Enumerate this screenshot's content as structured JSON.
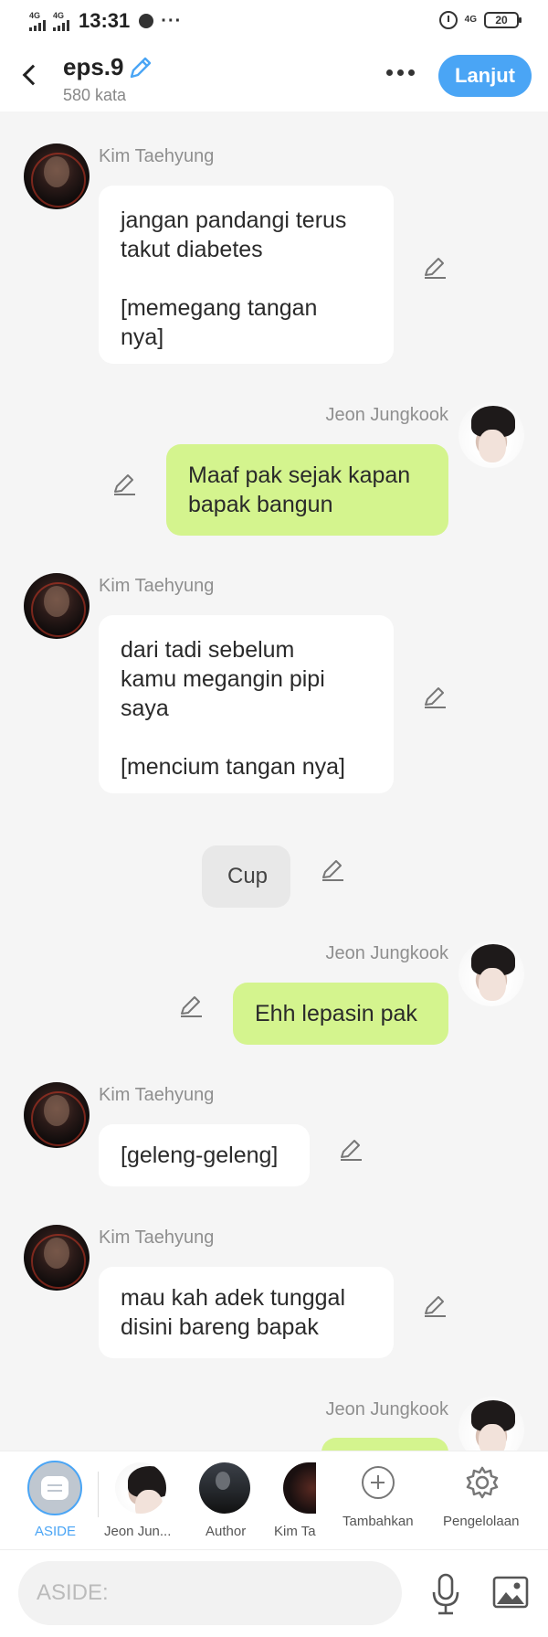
{
  "status_bar": {
    "signal1": "4G",
    "signal2": "4G",
    "time": "13:31",
    "dots": "···",
    "network": "4G",
    "battery": "20"
  },
  "header": {
    "title": "eps.9",
    "subtitle": "580 kata",
    "next_label": "Lanjut",
    "accent": "#4aa5f5"
  },
  "messages": [
    {
      "speaker": "Kim Taehyung",
      "side": "left",
      "text": "jangan pandangi terus\ntakut diabetes\n\n[memegang tangan\nnya]"
    },
    {
      "speaker": "Jeon Jungkook",
      "side": "right",
      "text": "Maaf pak sejak kapan\nbapak bangun"
    },
    {
      "speaker": "Kim Taehyung",
      "side": "left",
      "text": "dari tadi sebelum\nkamu megangin pipi\nsaya\n\n[mencium tangan nya]"
    },
    {
      "speaker": "",
      "side": "center",
      "text": "Cup"
    },
    {
      "speaker": "Jeon Jungkook",
      "side": "right",
      "text": "Ehh lepasin pak"
    },
    {
      "speaker": "Kim Taehyung",
      "side": "left",
      "text": "[geleng-geleng]"
    },
    {
      "speaker": "Kim Taehyung",
      "side": "left",
      "text": "mau kah adek tunggal\ndisini bareng bapak"
    },
    {
      "speaker": "Jeon Jungkook",
      "side": "right",
      "text": ""
    }
  ],
  "character_bar": {
    "aside_label": "ASIDE",
    "characters": [
      "Jeon Jun...",
      "Author",
      "Kim Ta"
    ],
    "add_label": "Tambahkan",
    "manage_label": "Pengelolaan"
  },
  "input": {
    "placeholder": "ASIDE:"
  },
  "colors": {
    "left_bubble": "#ffffff",
    "right_bubble": "#d4f48e",
    "background": "#f5f5f5"
  }
}
